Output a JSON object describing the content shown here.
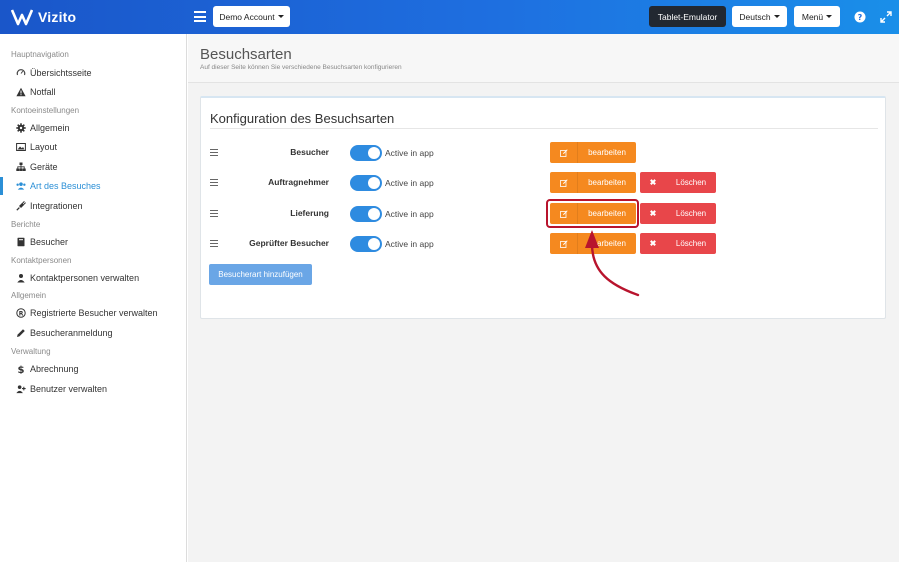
{
  "app": {
    "name": "Vizito"
  },
  "topbar": {
    "account_label": "Demo Account",
    "tablet_label": "Tablet-Emulator",
    "language_label": "Deutsch",
    "menu_label": "Menü",
    "help_icon": "question-circle-icon",
    "expand_icon": "expand-icon"
  },
  "sidebar": {
    "sections": [
      {
        "title": "Hauptnavigation",
        "items": [
          {
            "label": "Übersichtsseite",
            "icon": "dashboard-icon"
          },
          {
            "label": "Notfall",
            "icon": "warning-icon"
          }
        ]
      },
      {
        "title": "Kontoeinstellungen",
        "items": [
          {
            "label": "Allgemein",
            "icon": "gear-icon"
          },
          {
            "label": "Layout",
            "icon": "image-icon"
          },
          {
            "label": "Geräte",
            "icon": "sitemap-icon"
          },
          {
            "label": "Art des Besuches",
            "icon": "users-icon",
            "active": true
          },
          {
            "label": "Integrationen",
            "icon": "plug-icon"
          }
        ]
      },
      {
        "title": "Berichte",
        "items": [
          {
            "label": "Besucher",
            "icon": "book-icon"
          }
        ]
      },
      {
        "title": "Kontaktpersonen",
        "items": [
          {
            "label": "Kontaktpersonen verwalten",
            "icon": "user-icon"
          }
        ]
      },
      {
        "title": "Allgemein",
        "items": [
          {
            "label": "Registrierte Besucher verwalten",
            "icon": "registered-icon"
          },
          {
            "label": "Besucheranmeldung",
            "icon": "pencil-icon"
          }
        ]
      },
      {
        "title": "Verwaltung",
        "items": [
          {
            "label": "Abrechnung",
            "icon": "dollar-icon"
          },
          {
            "label": "Benutzer verwalten",
            "icon": "user-plus-icon"
          }
        ]
      }
    ]
  },
  "page": {
    "title": "Besuchsarten",
    "subtitle": "Auf dieser Seite können Sie verschiedene Besuchsarten konfigurieren"
  },
  "panel": {
    "title": "Konfiguration des Besuchsarten",
    "rows": [
      {
        "label": "Besucher",
        "toggle_label": "Active in app",
        "active": true,
        "edit_label": "bearbeiten",
        "delete_label": null
      },
      {
        "label": "Auftragnehmer",
        "toggle_label": "Active in app",
        "active": true,
        "edit_label": "bearbeiten",
        "delete_label": "Löschen"
      },
      {
        "label": "Lieferung",
        "toggle_label": "Active in app",
        "active": true,
        "edit_label": "bearbeiten",
        "delete_label": "Löschen",
        "highlighted": true
      },
      {
        "label": "Geprüfter Besucher",
        "toggle_label": "Active in app",
        "active": true,
        "edit_label": "bearbeiten",
        "delete_label": "Löschen"
      }
    ],
    "add_button_label": "Besucherart hinzufügen"
  },
  "colors": {
    "topbar_start": "#1a56c9",
    "topbar_end": "#1a8fe9",
    "accent": "#2b8fd6",
    "edit_button": "#f5891f",
    "delete_button": "#e8464a",
    "highlight": "#b8142d"
  }
}
